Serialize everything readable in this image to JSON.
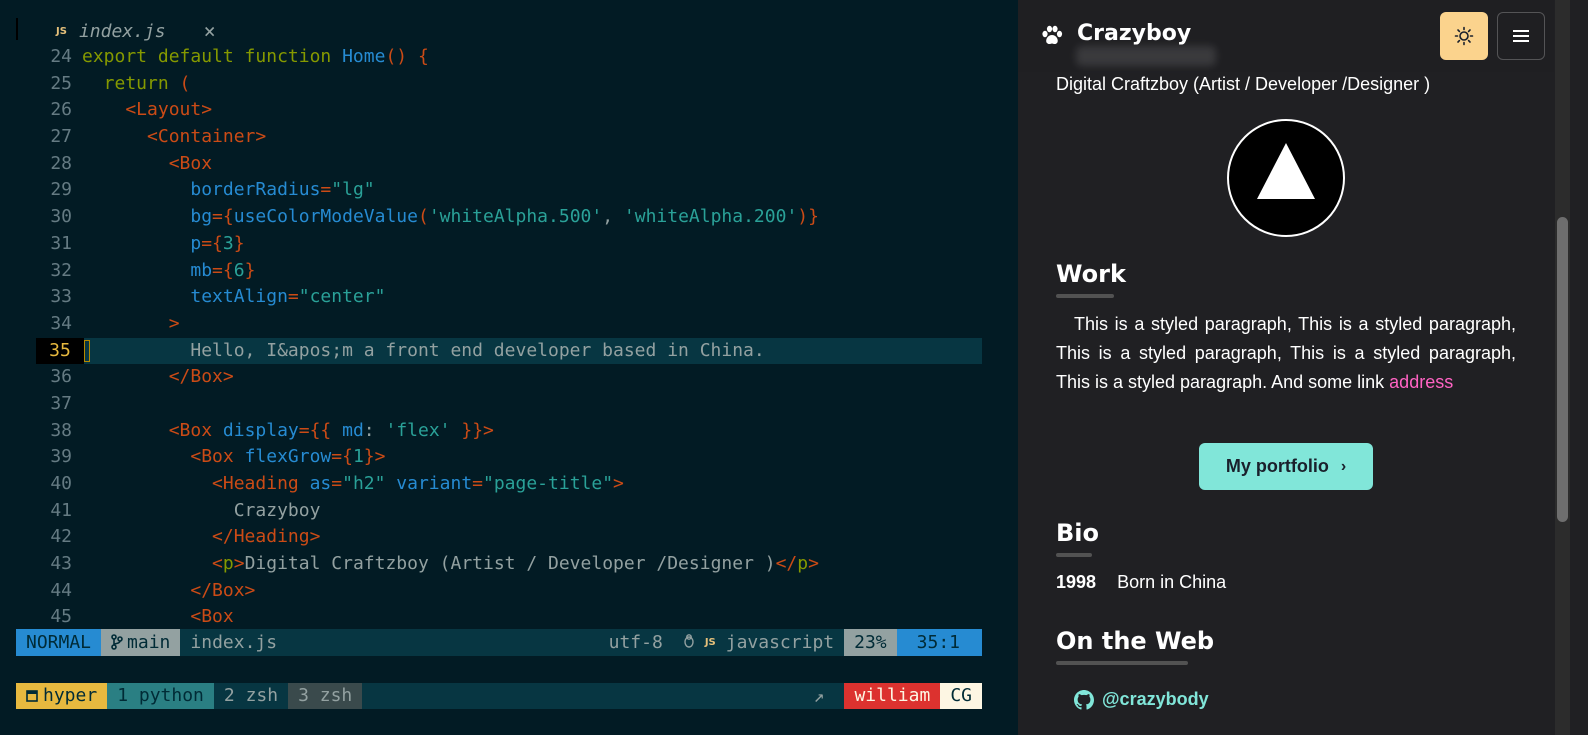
{
  "editor": {
    "tab": {
      "badge": "JS",
      "filename": "index.js",
      "close": "×"
    },
    "lines": [
      {
        "n": "24",
        "tokens": [
          {
            "t": "export default function ",
            "c": "kw"
          },
          {
            "t": "Home",
            "c": "fn"
          },
          {
            "t": "() {",
            "c": "br"
          }
        ]
      },
      {
        "n": "25",
        "tokens": [
          {
            "t": "  return ",
            "c": "kw"
          },
          {
            "t": "(",
            "c": "br"
          }
        ]
      },
      {
        "n": "26",
        "tokens": [
          {
            "t": "    <Layout>",
            "c": "tag"
          }
        ]
      },
      {
        "n": "27",
        "tokens": [
          {
            "t": "      <Container>",
            "c": "tag"
          }
        ]
      },
      {
        "n": "28",
        "tokens": [
          {
            "t": "        <Box",
            "c": "tag"
          }
        ]
      },
      {
        "n": "29",
        "tokens": [
          {
            "t": "          borderRadius",
            "c": "attr"
          },
          {
            "t": "=",
            "c": "br"
          },
          {
            "t": "\"lg\"",
            "c": "str"
          }
        ]
      },
      {
        "n": "30",
        "tokens": [
          {
            "t": "          bg",
            "c": "attr"
          },
          {
            "t": "={",
            "c": "br"
          },
          {
            "t": "useColorModeValue",
            "c": "fn"
          },
          {
            "t": "(",
            "c": "br"
          },
          {
            "t": "'whiteAlpha.500'",
            "c": "str"
          },
          {
            "t": ", ",
            "c": "txt"
          },
          {
            "t": "'whiteAlpha.200'",
            "c": "str"
          },
          {
            "t": ")}",
            "c": "br"
          }
        ]
      },
      {
        "n": "31",
        "tokens": [
          {
            "t": "          p",
            "c": "attr"
          },
          {
            "t": "={",
            "c": "br"
          },
          {
            "t": "3",
            "c": "num"
          },
          {
            "t": "}",
            "c": "br"
          }
        ]
      },
      {
        "n": "32",
        "tokens": [
          {
            "t": "          mb",
            "c": "attr"
          },
          {
            "t": "={",
            "c": "br"
          },
          {
            "t": "6",
            "c": "num"
          },
          {
            "t": "}",
            "c": "br"
          }
        ]
      },
      {
        "n": "33",
        "tokens": [
          {
            "t": "          textAlign",
            "c": "attr"
          },
          {
            "t": "=",
            "c": "br"
          },
          {
            "t": "\"center\"",
            "c": "str"
          }
        ]
      },
      {
        "n": "34",
        "tokens": [
          {
            "t": "        >",
            "c": "tag"
          }
        ]
      },
      {
        "n": "35",
        "current": true,
        "tokens": [
          {
            "t": "          Hello, I&apos;m a front end developer based in China.",
            "c": "txt"
          }
        ]
      },
      {
        "n": "36",
        "tokens": [
          {
            "t": "        </Box>",
            "c": "tag"
          }
        ]
      },
      {
        "n": "37",
        "tokens": []
      },
      {
        "n": "38",
        "tokens": [
          {
            "t": "        <Box ",
            "c": "tag"
          },
          {
            "t": "display",
            "c": "attr"
          },
          {
            "t": "={{ ",
            "c": "br"
          },
          {
            "t": "md",
            "c": "attr"
          },
          {
            "t": ": ",
            "c": "txt"
          },
          {
            "t": "'flex'",
            "c": "str"
          },
          {
            "t": " }}>",
            "c": "br"
          }
        ]
      },
      {
        "n": "39",
        "tokens": [
          {
            "t": "          <Box ",
            "c": "tag"
          },
          {
            "t": "flexGrow",
            "c": "attr"
          },
          {
            "t": "={",
            "c": "br"
          },
          {
            "t": "1",
            "c": "num"
          },
          {
            "t": "}>",
            "c": "br"
          }
        ]
      },
      {
        "n": "40",
        "tokens": [
          {
            "t": "            <Heading ",
            "c": "tag"
          },
          {
            "t": "as",
            "c": "attr"
          },
          {
            "t": "=",
            "c": "br"
          },
          {
            "t": "\"h2\" ",
            "c": "str"
          },
          {
            "t": "variant",
            "c": "attr"
          },
          {
            "t": "=",
            "c": "br"
          },
          {
            "t": "\"page-title\"",
            "c": "str"
          },
          {
            "t": ">",
            "c": "tag"
          }
        ]
      },
      {
        "n": "41",
        "tokens": [
          {
            "t": "              Crazyboy",
            "c": "txt"
          }
        ]
      },
      {
        "n": "42",
        "tokens": [
          {
            "t": "            </Heading>",
            "c": "tag"
          }
        ]
      },
      {
        "n": "43",
        "tokens": [
          {
            "t": "            <",
            "c": "tag"
          },
          {
            "t": "p",
            "c": "kw"
          },
          {
            "t": ">",
            "c": "tag"
          },
          {
            "t": "Digital Craftzboy (Artist / Developer /Designer )",
            "c": "txt"
          },
          {
            "t": "</",
            "c": "tag"
          },
          {
            "t": "p",
            "c": "kw"
          },
          {
            "t": ">",
            "c": "tag"
          }
        ]
      },
      {
        "n": "44",
        "tokens": [
          {
            "t": "          </Box>",
            "c": "tag"
          }
        ]
      },
      {
        "n": "45",
        "tokens": [
          {
            "t": "          <Box",
            "c": "tag"
          }
        ]
      }
    ]
  },
  "statusline": {
    "mode": "NORMAL",
    "branch": "main",
    "branch_icon": "git-branch-icon",
    "file": "index.js",
    "encoding": "utf-8",
    "os_icon": "tux-icon",
    "filetype_badge": "JS",
    "filetype": "javascript",
    "percent": "23%",
    "position": "35:1"
  },
  "tmux": {
    "session": "hyper",
    "windows": [
      {
        "label": "1 python",
        "state": "active"
      },
      {
        "label": "2 zsh",
        "state": "normal"
      },
      {
        "label": "3 zsh",
        "state": "dim"
      }
    ],
    "arrow": "↗",
    "user": "william",
    "host": "CG"
  },
  "browser": {
    "brand": "Crazyboy",
    "description": "Digital Craftzboy (Artist / Developer /Designer )",
    "work_heading": "Work",
    "work_paragraph": "This is a styled paragraph, This is a styled paragraph, This is a styled paragraph, This is a styled paragraph, This is a styled paragraph. And some link ",
    "work_link": "address",
    "portfolio_button": "My portfolio",
    "portfolio_chevron": "›",
    "bio_heading": "Bio",
    "bio": [
      {
        "year": "1998",
        "text": "Born in China"
      }
    ],
    "web_heading": "On the Web",
    "web_links": [
      {
        "label": "@crazybody",
        "icon": "github-icon"
      }
    ],
    "colors": {
      "accent": "#81e6d9",
      "link": "#ff63c3",
      "theme_button": "#fbd38d",
      "background": "#202023"
    }
  }
}
